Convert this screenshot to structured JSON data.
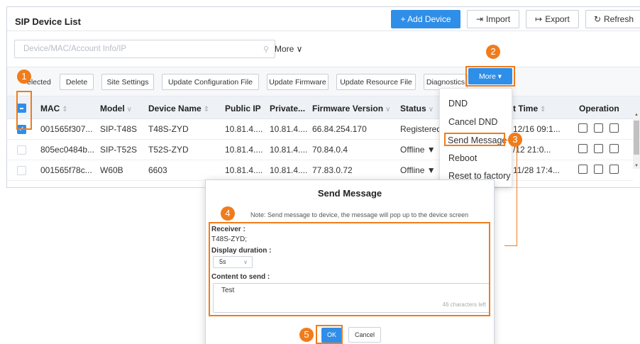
{
  "header": {
    "title": "SIP Device List",
    "add_device": "+ Add Device",
    "import": "Import",
    "export": "Export",
    "refresh": "Refresh"
  },
  "filter": {
    "search_placeholder": "Device/MAC/Account Info/IP",
    "more": "More ∨"
  },
  "toolbar": {
    "selected": "elected",
    "delete": "Delete",
    "site_settings": "Site Settings",
    "update_config": "Update Configuration File",
    "update_firmware": "Update Firmware",
    "update_resource": "Update Resource File",
    "diagnostics": "Diagnostics",
    "more": "More ▾"
  },
  "columns": {
    "mac": "MAC",
    "model": "Model",
    "device_name": "Device Name",
    "public_ip": "Public IP",
    "private_ip": "Private...",
    "firmware": "Firmware Version",
    "status": "Status",
    "time": "t Time",
    "operation": "Operation"
  },
  "rows": [
    {
      "mac": "001565f307...",
      "model": "SIP-T48S",
      "name": "T48S-ZYD",
      "public_ip": "10.81.4....",
      "private_ip": "10.81.4....",
      "firmware": "66.84.254.170",
      "status": "Registered",
      "time": "12/16 09:1...",
      "checked": true
    },
    {
      "mac": "805ec0484b...",
      "model": "SIP-T52S",
      "name": "T52S-ZYD",
      "public_ip": "10.81.4....",
      "private_ip": "10.81.4....",
      "firmware": "70.84.0.4",
      "status": "Offline ▼",
      "time": "/12 21:0...",
      "checked": false
    },
    {
      "mac": "001565f78c...",
      "model": "W60B",
      "name": "6603",
      "public_ip": "10.81.4....",
      "private_ip": "10.81.4....",
      "firmware": "77.83.0.72",
      "status": "Offline ▼",
      "time": "11/28 17:4...",
      "checked": false
    }
  ],
  "menu": {
    "dnd": "DND",
    "cancel_dnd": "Cancel DND",
    "send_message": "Send Message",
    "reboot": "Reboot",
    "reset": "Reset to factory"
  },
  "dialog": {
    "title": "Send Message",
    "note": "Note: Send message to device, the message will pop up to the device screen",
    "receiver_label": "Receiver :",
    "receiver_value": "T48S-ZYD;",
    "duration_label": "Display duration :",
    "duration_value": "5s",
    "content_label": "Content to send :",
    "content_value": "Test",
    "char_count": "46 characters left",
    "ok": "OK",
    "cancel": "Cancel"
  },
  "annotations": [
    "1",
    "2",
    "3",
    "4",
    "5"
  ],
  "colors": {
    "accent": "#2f8ee8",
    "annotation": "#f07c1b"
  }
}
